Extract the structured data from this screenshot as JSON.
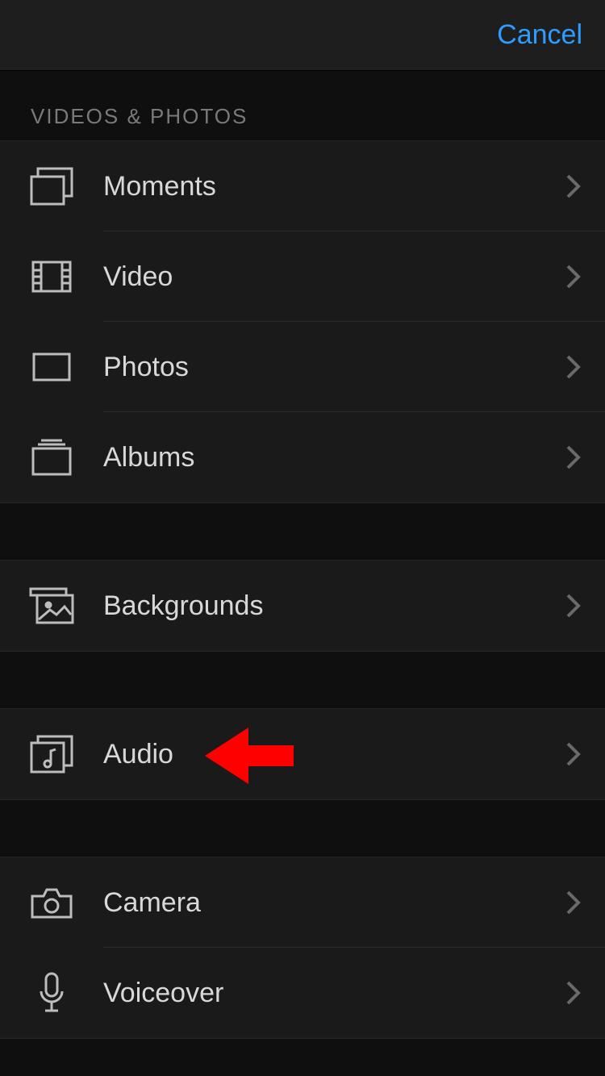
{
  "nav": {
    "cancel_label": "Cancel"
  },
  "section_header": "VIDEOS & PHOTOS",
  "rows": {
    "moments": {
      "label": "Moments"
    },
    "video": {
      "label": "Video"
    },
    "photos": {
      "label": "Photos"
    },
    "albums": {
      "label": "Albums"
    },
    "backgrounds": {
      "label": "Backgrounds"
    },
    "audio": {
      "label": "Audio"
    },
    "camera": {
      "label": "Camera"
    },
    "voiceover": {
      "label": "Voiceover"
    }
  }
}
